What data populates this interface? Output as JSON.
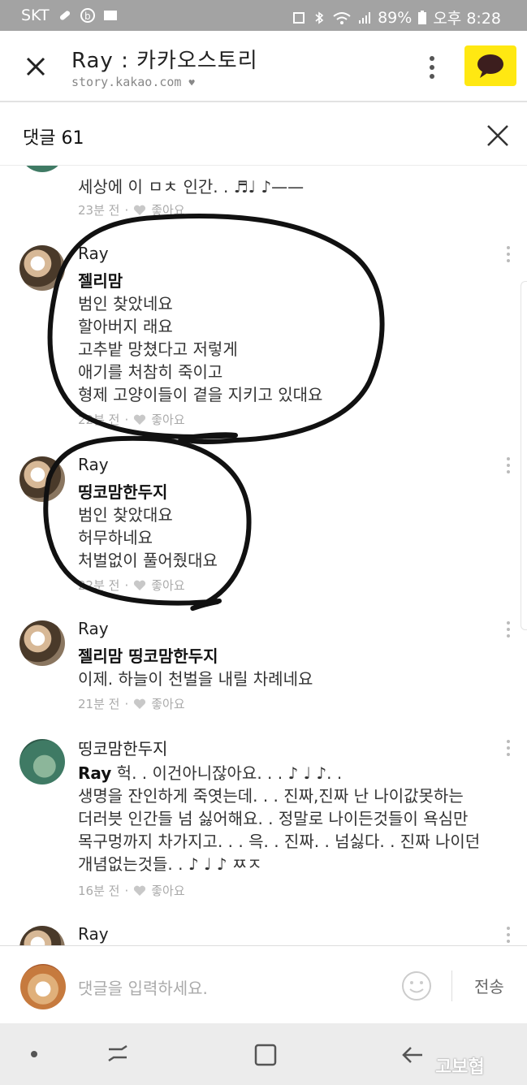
{
  "status_bar": {
    "carrier": "SKT",
    "battery": "89%",
    "time": "오후 8:28"
  },
  "browser": {
    "title": "Ray : 카카오스토리",
    "url": "story.kakao.com"
  },
  "comments": {
    "title": "댓글 61",
    "items": [
      {
        "author": "",
        "lines": [
          "세상에 이 ㅁㅊ 인간. . ♬♩ ♪——"
        ],
        "time": "23분 전",
        "like": "좋아요"
      },
      {
        "author": "Ray",
        "mention": "젤리맘",
        "lines": [
          "범인 찾았네요",
          "할아버지 래요",
          "고추밭 망쳤다고 저렇게",
          "애기를 처참히 죽이고",
          "형제 고양이들이 곁을 지키고 있대요"
        ],
        "time": "22분 전",
        "like": "좋아요"
      },
      {
        "author": "Ray",
        "mention": "띵코맘한두지",
        "lines": [
          "범인 찾았대요",
          "허무하네요",
          "처벌없이 풀어줬대요"
        ],
        "time": "22분 전",
        "like": "좋아요"
      },
      {
        "author": "Ray",
        "mention": "젤리맘 띵코맘한두지",
        "lines": [
          "이제. 하늘이 천벌을 내릴 차례네요"
        ],
        "time": "21분 전",
        "like": "좋아요"
      },
      {
        "author": "띵코맘한두지",
        "mention": "Ray",
        "first_line": " 헉. .   이건아니잖아요. . . ♪ ♩ ♪. .",
        "lines": [
          "생명을  잔인하게 죽엿는데. . . 진짜,진짜 난 나이값못하는",
          "더러븟 인간들  넘 싫어해요. . 정말로 나이든것들이  욕심만",
          "목구멍까지 차가지고. . . 윽. . 진짜. . 넘싫다. . 진짜 나이던",
          "개념없는것들. . ♪ ♩ ♪  ㅉㅈ"
        ],
        "time": "16분 전",
        "like": "좋아요"
      },
      {
        "author": "Ray"
      }
    ]
  },
  "input": {
    "placeholder": "댓글을 입력하세요.",
    "send": "전송"
  },
  "watermark": "고보협"
}
